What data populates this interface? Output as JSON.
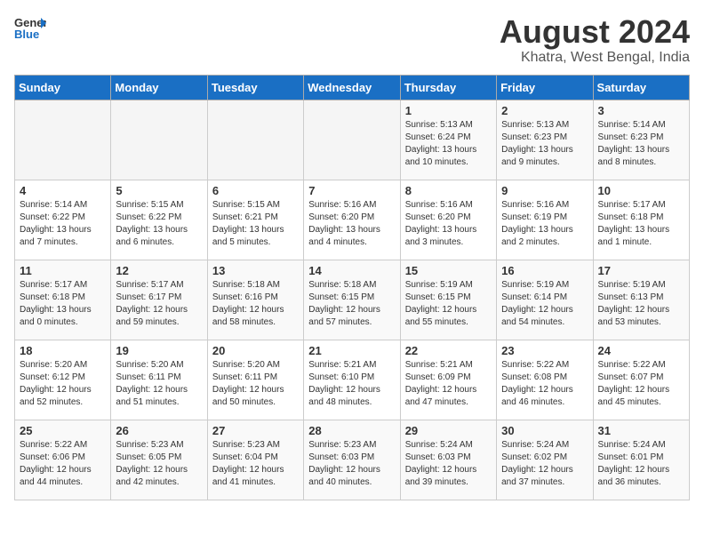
{
  "logo": {
    "line1": "General",
    "line2": "Blue"
  },
  "title": "August 2024",
  "location": "Khatra, West Bengal, India",
  "days_of_week": [
    "Sunday",
    "Monday",
    "Tuesday",
    "Wednesday",
    "Thursday",
    "Friday",
    "Saturday"
  ],
  "weeks": [
    [
      {
        "day": "",
        "sunrise": "",
        "sunset": "",
        "daylight": ""
      },
      {
        "day": "",
        "sunrise": "",
        "sunset": "",
        "daylight": ""
      },
      {
        "day": "",
        "sunrise": "",
        "sunset": "",
        "daylight": ""
      },
      {
        "day": "",
        "sunrise": "",
        "sunset": "",
        "daylight": ""
      },
      {
        "day": "1",
        "sunrise": "Sunrise: 5:13 AM",
        "sunset": "Sunset: 6:24 PM",
        "daylight": "Daylight: 13 hours and 10 minutes."
      },
      {
        "day": "2",
        "sunrise": "Sunrise: 5:13 AM",
        "sunset": "Sunset: 6:23 PM",
        "daylight": "Daylight: 13 hours and 9 minutes."
      },
      {
        "day": "3",
        "sunrise": "Sunrise: 5:14 AM",
        "sunset": "Sunset: 6:23 PM",
        "daylight": "Daylight: 13 hours and 8 minutes."
      }
    ],
    [
      {
        "day": "4",
        "sunrise": "Sunrise: 5:14 AM",
        "sunset": "Sunset: 6:22 PM",
        "daylight": "Daylight: 13 hours and 7 minutes."
      },
      {
        "day": "5",
        "sunrise": "Sunrise: 5:15 AM",
        "sunset": "Sunset: 6:22 PM",
        "daylight": "Daylight: 13 hours and 6 minutes."
      },
      {
        "day": "6",
        "sunrise": "Sunrise: 5:15 AM",
        "sunset": "Sunset: 6:21 PM",
        "daylight": "Daylight: 13 hours and 5 minutes."
      },
      {
        "day": "7",
        "sunrise": "Sunrise: 5:16 AM",
        "sunset": "Sunset: 6:20 PM",
        "daylight": "Daylight: 13 hours and 4 minutes."
      },
      {
        "day": "8",
        "sunrise": "Sunrise: 5:16 AM",
        "sunset": "Sunset: 6:20 PM",
        "daylight": "Daylight: 13 hours and 3 minutes."
      },
      {
        "day": "9",
        "sunrise": "Sunrise: 5:16 AM",
        "sunset": "Sunset: 6:19 PM",
        "daylight": "Daylight: 13 hours and 2 minutes."
      },
      {
        "day": "10",
        "sunrise": "Sunrise: 5:17 AM",
        "sunset": "Sunset: 6:18 PM",
        "daylight": "Daylight: 13 hours and 1 minute."
      }
    ],
    [
      {
        "day": "11",
        "sunrise": "Sunrise: 5:17 AM",
        "sunset": "Sunset: 6:18 PM",
        "daylight": "Daylight: 13 hours and 0 minutes."
      },
      {
        "day": "12",
        "sunrise": "Sunrise: 5:17 AM",
        "sunset": "Sunset: 6:17 PM",
        "daylight": "Daylight: 12 hours and 59 minutes."
      },
      {
        "day": "13",
        "sunrise": "Sunrise: 5:18 AM",
        "sunset": "Sunset: 6:16 PM",
        "daylight": "Daylight: 12 hours and 58 minutes."
      },
      {
        "day": "14",
        "sunrise": "Sunrise: 5:18 AM",
        "sunset": "Sunset: 6:15 PM",
        "daylight": "Daylight: 12 hours and 57 minutes."
      },
      {
        "day": "15",
        "sunrise": "Sunrise: 5:19 AM",
        "sunset": "Sunset: 6:15 PM",
        "daylight": "Daylight: 12 hours and 55 minutes."
      },
      {
        "day": "16",
        "sunrise": "Sunrise: 5:19 AM",
        "sunset": "Sunset: 6:14 PM",
        "daylight": "Daylight: 12 hours and 54 minutes."
      },
      {
        "day": "17",
        "sunrise": "Sunrise: 5:19 AM",
        "sunset": "Sunset: 6:13 PM",
        "daylight": "Daylight: 12 hours and 53 minutes."
      }
    ],
    [
      {
        "day": "18",
        "sunrise": "Sunrise: 5:20 AM",
        "sunset": "Sunset: 6:12 PM",
        "daylight": "Daylight: 12 hours and 52 minutes."
      },
      {
        "day": "19",
        "sunrise": "Sunrise: 5:20 AM",
        "sunset": "Sunset: 6:11 PM",
        "daylight": "Daylight: 12 hours and 51 minutes."
      },
      {
        "day": "20",
        "sunrise": "Sunrise: 5:20 AM",
        "sunset": "Sunset: 6:11 PM",
        "daylight": "Daylight: 12 hours and 50 minutes."
      },
      {
        "day": "21",
        "sunrise": "Sunrise: 5:21 AM",
        "sunset": "Sunset: 6:10 PM",
        "daylight": "Daylight: 12 hours and 48 minutes."
      },
      {
        "day": "22",
        "sunrise": "Sunrise: 5:21 AM",
        "sunset": "Sunset: 6:09 PM",
        "daylight": "Daylight: 12 hours and 47 minutes."
      },
      {
        "day": "23",
        "sunrise": "Sunrise: 5:22 AM",
        "sunset": "Sunset: 6:08 PM",
        "daylight": "Daylight: 12 hours and 46 minutes."
      },
      {
        "day": "24",
        "sunrise": "Sunrise: 5:22 AM",
        "sunset": "Sunset: 6:07 PM",
        "daylight": "Daylight: 12 hours and 45 minutes."
      }
    ],
    [
      {
        "day": "25",
        "sunrise": "Sunrise: 5:22 AM",
        "sunset": "Sunset: 6:06 PM",
        "daylight": "Daylight: 12 hours and 44 minutes."
      },
      {
        "day": "26",
        "sunrise": "Sunrise: 5:23 AM",
        "sunset": "Sunset: 6:05 PM",
        "daylight": "Daylight: 12 hours and 42 minutes."
      },
      {
        "day": "27",
        "sunrise": "Sunrise: 5:23 AM",
        "sunset": "Sunset: 6:04 PM",
        "daylight": "Daylight: 12 hours and 41 minutes."
      },
      {
        "day": "28",
        "sunrise": "Sunrise: 5:23 AM",
        "sunset": "Sunset: 6:03 PM",
        "daylight": "Daylight: 12 hours and 40 minutes."
      },
      {
        "day": "29",
        "sunrise": "Sunrise: 5:24 AM",
        "sunset": "Sunset: 6:03 PM",
        "daylight": "Daylight: 12 hours and 39 minutes."
      },
      {
        "day": "30",
        "sunrise": "Sunrise: 5:24 AM",
        "sunset": "Sunset: 6:02 PM",
        "daylight": "Daylight: 12 hours and 37 minutes."
      },
      {
        "day": "31",
        "sunrise": "Sunrise: 5:24 AM",
        "sunset": "Sunset: 6:01 PM",
        "daylight": "Daylight: 12 hours and 36 minutes."
      }
    ]
  ]
}
